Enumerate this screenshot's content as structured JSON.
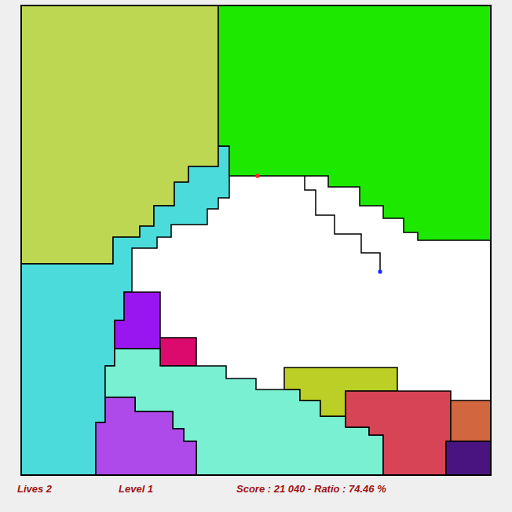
{
  "game": {
    "regions": [
      {
        "color": "#bdd752"
      },
      {
        "color": "#4cdbdb"
      },
      {
        "color": "#1de900"
      },
      {
        "color": "#9a16f0"
      },
      {
        "color": "#dc0a6c"
      },
      {
        "color": "#7af0d2"
      },
      {
        "color": "#bccf27"
      },
      {
        "color": "#ad4ae9"
      },
      {
        "color": "#d64456"
      },
      {
        "color": "#d2663f"
      },
      {
        "color": "#491480"
      }
    ]
  },
  "status_bar": {
    "lives": "Lives 2",
    "level": "Level 1",
    "score": "Score : 21 040 - Ratio : 74.46 %"
  }
}
